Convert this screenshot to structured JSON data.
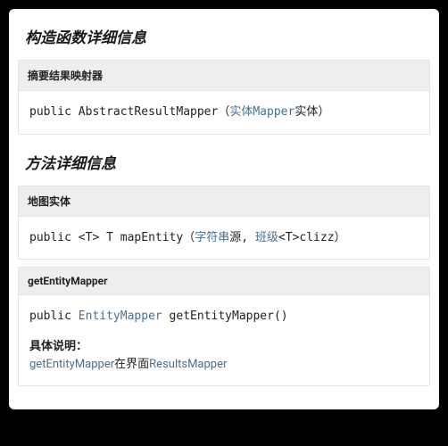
{
  "sections": {
    "constructor": {
      "title": "构造函数详细信息",
      "items": [
        {
          "header": "摘要结果映射器",
          "sig": {
            "modifier": "public",
            "type_plain": "",
            "name": "AbstractResultMapper",
            "open": "（",
            "close": "）",
            "params": [
              {
                "link": "实体Mapper",
                "after": "实体"
              }
            ]
          }
        }
      ]
    },
    "method": {
      "title": "方法详细信息",
      "items": [
        {
          "header": "地图实体",
          "sig": {
            "modifier": "public",
            "generic": "<T>",
            "ret_plain": "T",
            "name": "mapEntity",
            "open": "（",
            "close": "）",
            "params": [
              {
                "link": "字符串",
                "after": "源, "
              },
              {
                "link": "班级",
                "after": "<T>clizz"
              }
            ]
          }
        },
        {
          "header": "getEntityMapper",
          "sig": {
            "modifier": "public",
            "ret_link": "EntityMapper",
            "name": "getEntityMapper",
            "open": "(",
            "close": ")",
            "params": []
          },
          "desc": {
            "label": "具体说明：",
            "part1_link": "getEntityMapper",
            "mid": "在界面",
            "part2_link": "ResultsMapper"
          }
        }
      ]
    }
  }
}
